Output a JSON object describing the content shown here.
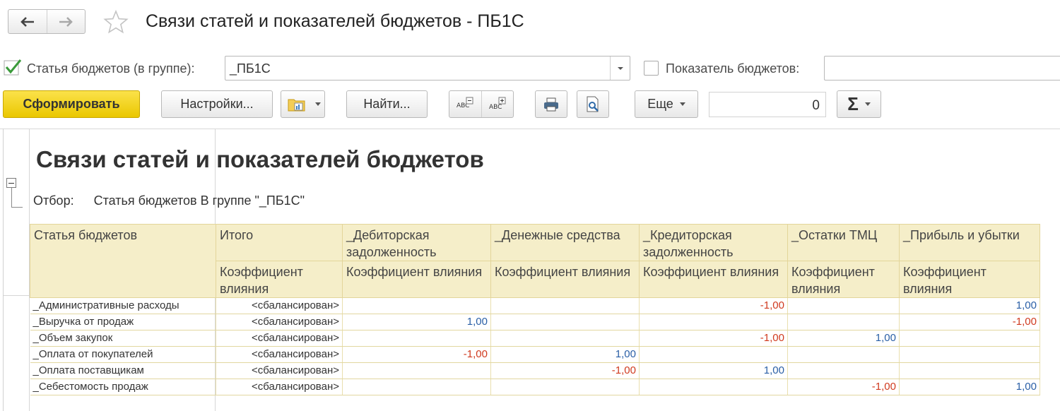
{
  "window": {
    "title": "Связи статей и показателей бюджетов - ПБ1С"
  },
  "filters": {
    "article_label": "Статья бюджетов (в группе):",
    "article_value": "_ПБ1С",
    "article_checked": true,
    "indicator_label": "Показатель бюджетов:",
    "indicator_checked": false,
    "indicator_value": ""
  },
  "toolbar": {
    "generate": "Сформировать",
    "settings": "Настройки...",
    "find": "Найти...",
    "more": "Еще",
    "number_value": "0",
    "sum_symbol": "Σ"
  },
  "report": {
    "title": "Связи статей и показателей бюджетов",
    "filter_label": "Отбор:",
    "filter_text": "Статья бюджетов В группе \"_ПБ1С\"",
    "header": {
      "article": "Статья бюджетов",
      "total": "Итого",
      "groups": [
        "_Дебиторская задолженность",
        "_Денежные средства",
        "_Кредиторская задолженность",
        "_Остатки ТМЦ",
        "_Прибыль и убытки"
      ],
      "coef": "Коэффициент влияния"
    },
    "rows": [
      {
        "name": "_Административные расходы",
        "total": "<сбалансирован>",
        "values": [
          "",
          "",
          "-1,00",
          "",
          "1,00"
        ]
      },
      {
        "name": "_Выручка от продаж",
        "total": "<сбалансирован>",
        "values": [
          "1,00",
          "",
          "",
          "",
          "-1,00"
        ]
      },
      {
        "name": "_Объем закупок",
        "total": "<сбалансирован>",
        "values": [
          "",
          "",
          "-1,00",
          "1,00",
          ""
        ]
      },
      {
        "name": "_Оплата от покупателей",
        "total": "<сбалансирован>",
        "values": [
          "-1,00",
          "1,00",
          "",
          "",
          ""
        ]
      },
      {
        "name": "_Оплата поставщикам",
        "total": "<сбалансирован>",
        "values": [
          "",
          "-1,00",
          "1,00",
          "",
          ""
        ]
      },
      {
        "name": "_Себестомость продаж",
        "total": "<сбалансирован>",
        "values": [
          "",
          "",
          "",
          "-1,00",
          "1,00"
        ]
      }
    ]
  },
  "colors": {
    "primary_button": "#f2d21b",
    "header_bg": "#f5eec9",
    "positive": "#2a5fa6",
    "negative": "#d03a1f",
    "check": "#3a9a3a"
  }
}
